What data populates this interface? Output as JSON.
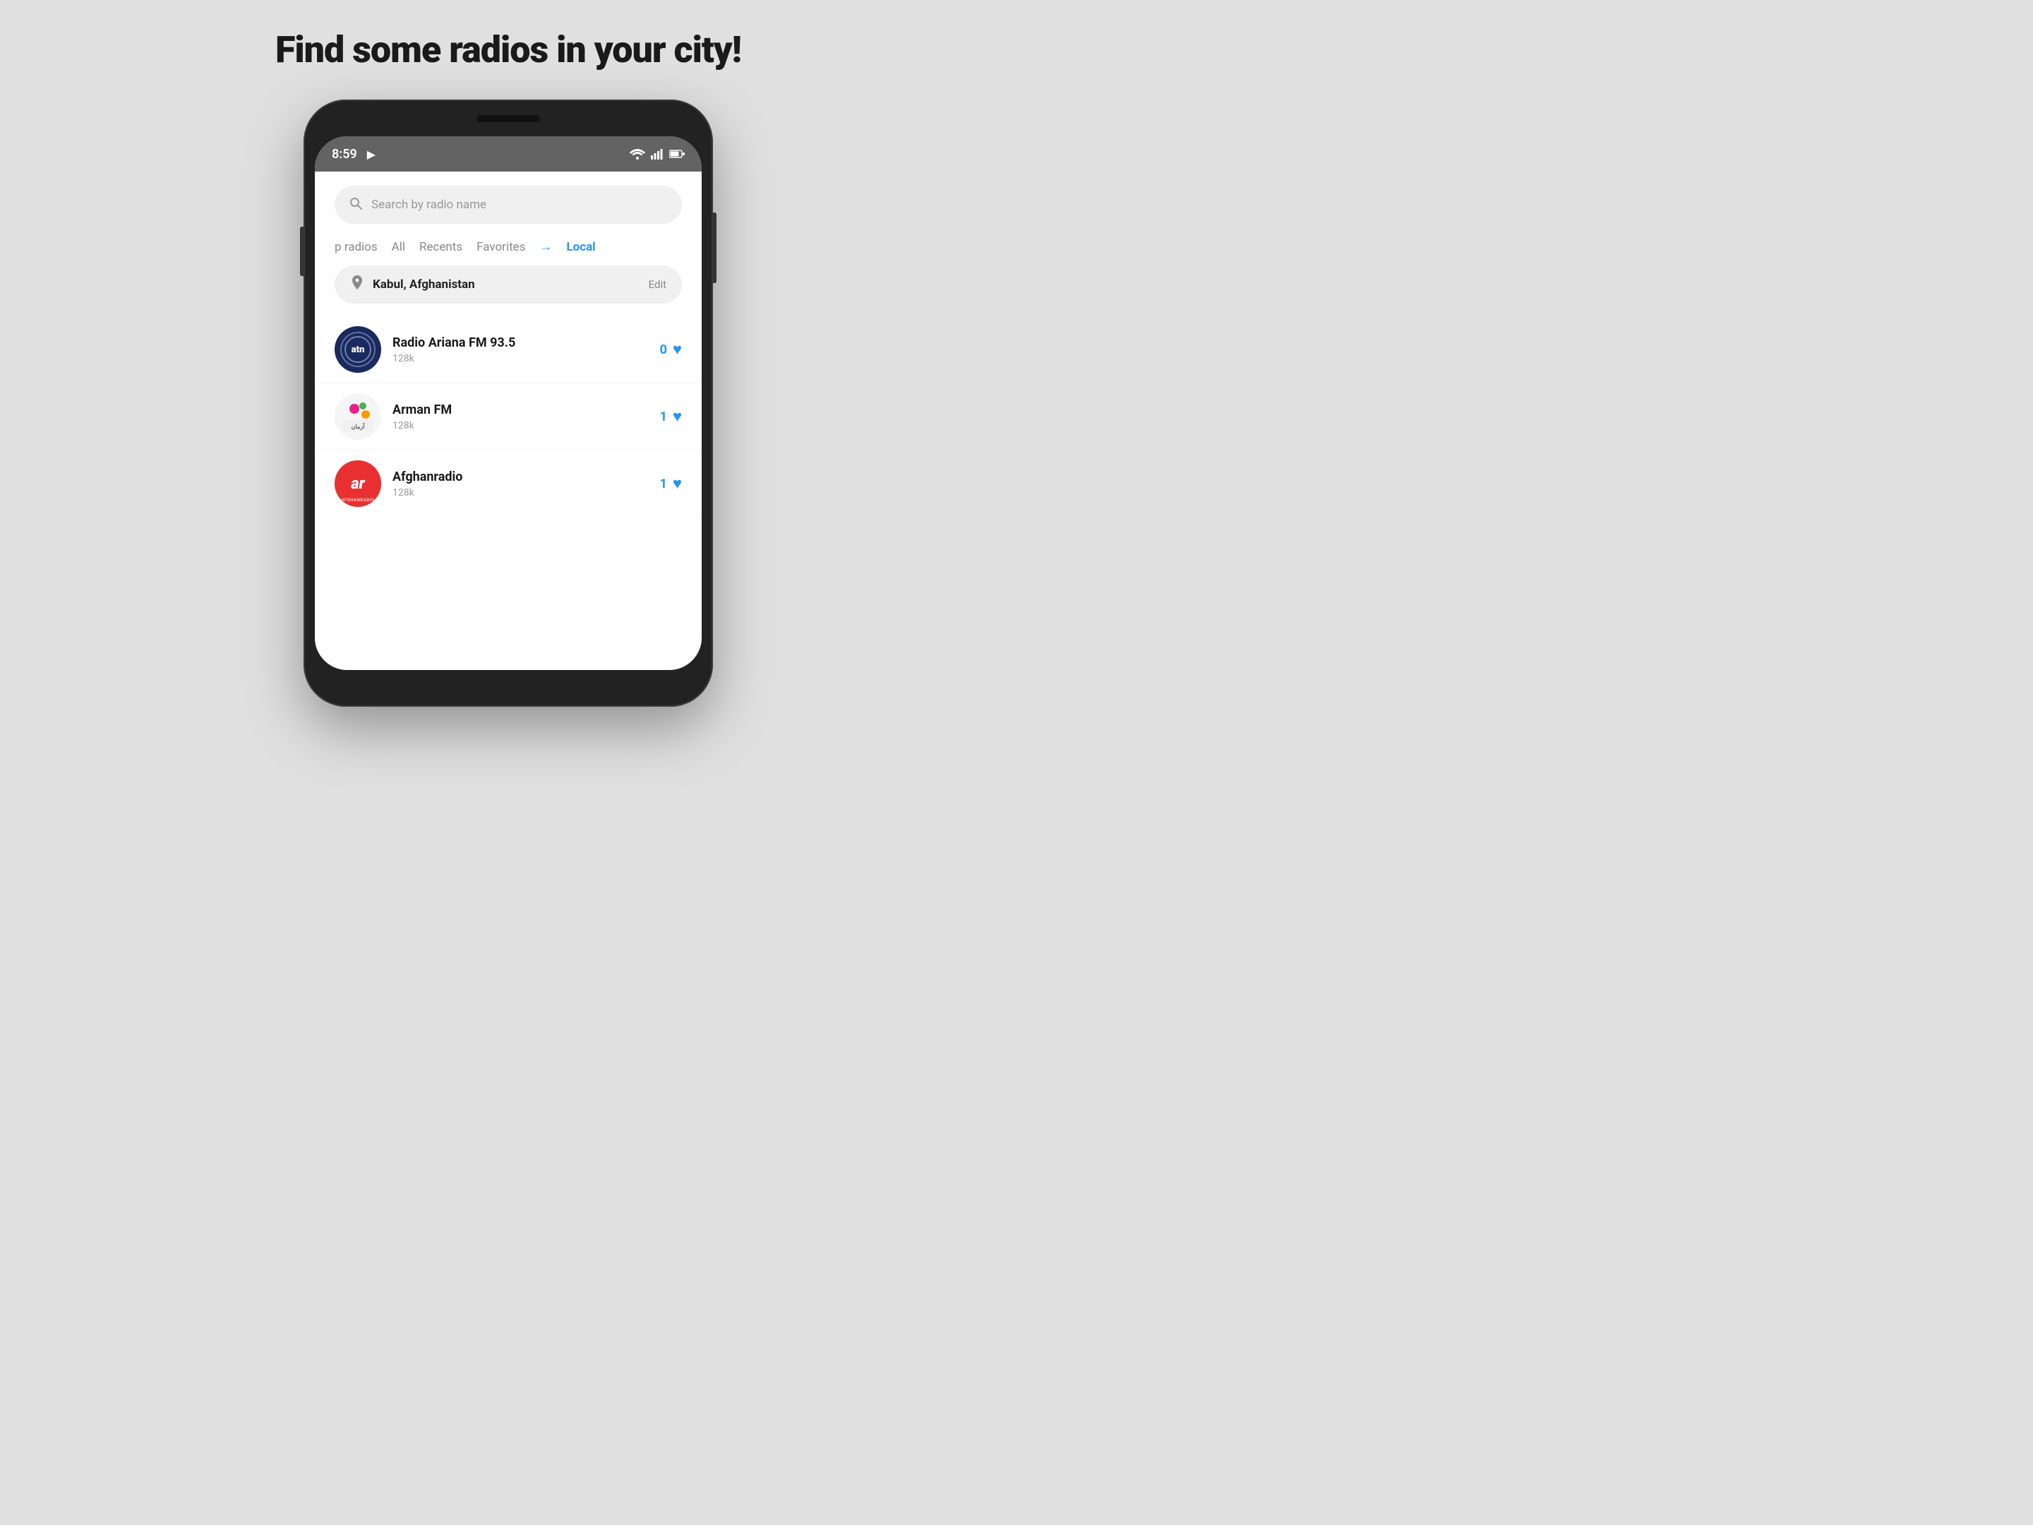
{
  "page": {
    "title": "Find some radios in your city!",
    "background_color": "#e0e0e0"
  },
  "status_bar": {
    "time": "8:59",
    "playing_icon": "▶",
    "wifi": "wifi",
    "signal": "signal",
    "battery": "battery"
  },
  "search": {
    "placeholder": "Search by radio name"
  },
  "tabs": [
    {
      "label": "p radios",
      "active": false
    },
    {
      "label": "All",
      "active": false
    },
    {
      "label": "Recents",
      "active": false
    },
    {
      "label": "Favorites",
      "active": false
    },
    {
      "label": "Local",
      "active": true
    }
  ],
  "location": {
    "city": "Kabul, Afghanistan",
    "edit_label": "Edit"
  },
  "radio_list": [
    {
      "name": "Radio Ariana FM 93.5",
      "bitrate": "128k",
      "fav_count": "0",
      "logo_type": "atn",
      "logo_text": "atn"
    },
    {
      "name": "Arman FM",
      "bitrate": "128k",
      "fav_count": "1",
      "logo_type": "arman",
      "logo_text": "Arman"
    },
    {
      "name": "Afghanradio",
      "bitrate": "128k",
      "fav_count": "1",
      "logo_type": "afghan",
      "logo_text": "ar"
    }
  ]
}
